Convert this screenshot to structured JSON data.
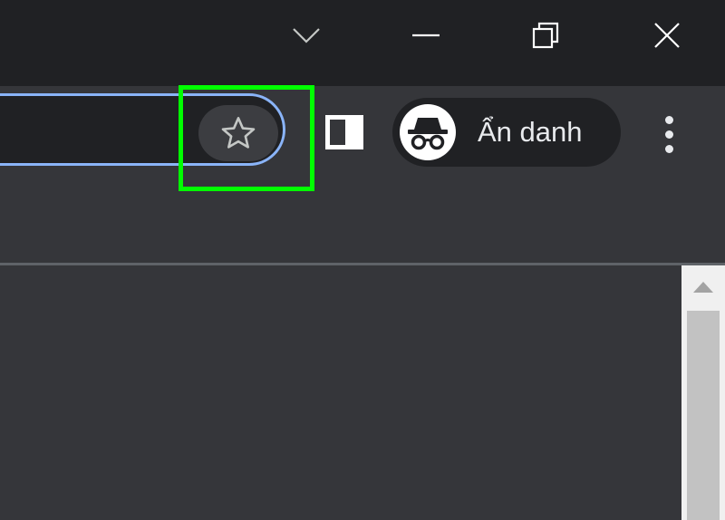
{
  "window": {
    "icons": {
      "tab_search": "chevron-down-icon",
      "minimize": "minimize-icon",
      "restore": "restore-icon",
      "close": "close-icon"
    }
  },
  "toolbar": {
    "bookmark_icon": "star-icon",
    "side_panel_icon": "side-panel-icon",
    "profile": {
      "label": "Ẩn danh",
      "icon": "incognito-icon"
    },
    "menu_icon": "more-vert-icon"
  },
  "colors": {
    "titlebar": "#202124",
    "toolbar": "#35363a",
    "omnibox_focus_ring": "#8ab4f8",
    "highlight": "#00ff00",
    "scrollbar_track": "#f0f0f0",
    "scrollbar_thumb": "#c2c2c2"
  }
}
